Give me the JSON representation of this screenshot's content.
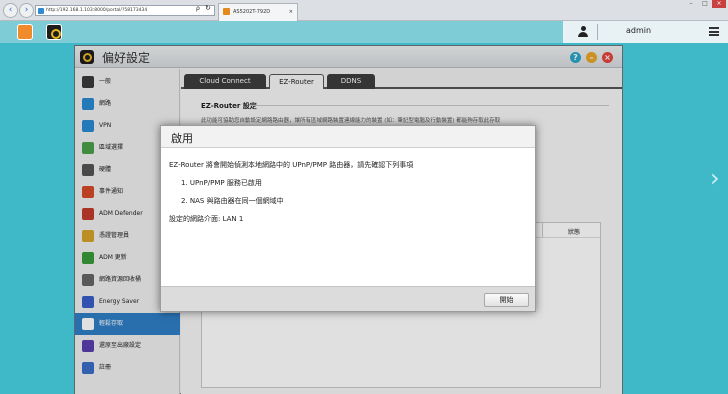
{
  "browser": {
    "url": "http://192.168.1.103:8000/portal/?58173434",
    "tab_title": "AS5202T-792D",
    "nav_back_icon": "back-arrow-icon",
    "nav_forward_icon": "forward-arrow-icon",
    "search_glyph": "ρ",
    "refresh_glyph": "↻"
  },
  "topbar": {
    "username": "admin"
  },
  "window": {
    "title": "偏好設定",
    "colors": {
      "help": "#2aa6c9",
      "minimize": "#e8a628",
      "close": "#e2443b"
    }
  },
  "sidebar": {
    "items": [
      {
        "label": "一般",
        "icon": "general-icon",
        "color": "#3b3b3b"
      },
      {
        "label": "網路",
        "icon": "network-icon",
        "color": "#2a8ad2"
      },
      {
        "label": "VPN",
        "icon": "vpn-icon",
        "color": "#2a8ad2"
      },
      {
        "label": "區域選擇",
        "icon": "region-icon",
        "color": "#4aa04a"
      },
      {
        "label": "硬體",
        "icon": "hardware-icon",
        "color": "#555555"
      },
      {
        "label": "事件通知",
        "icon": "notification-icon",
        "color": "#d44a2a"
      },
      {
        "label": "ADM Defender",
        "icon": "defender-icon",
        "color": "#c23b2b"
      },
      {
        "label": "憑證管理員",
        "icon": "certificate-icon",
        "color": "#d4a32a"
      },
      {
        "label": "ADM 更新",
        "icon": "update-icon",
        "color": "#3a9a3a"
      },
      {
        "label": "網路資源回收桶",
        "icon": "recycle-bin-icon",
        "color": "#666666"
      },
      {
        "label": "Energy Saver",
        "icon": "energy-saver-icon",
        "color": "#3a5ec8"
      },
      {
        "label": "輕鬆存取",
        "icon": "cloud-icon",
        "color": "#ffffff",
        "active": true
      },
      {
        "label": "還原至出廠設定",
        "icon": "restore-icon",
        "color": "#5b3fb0"
      },
      {
        "label": "註冊",
        "icon": "register-icon",
        "color": "#3a6ec8"
      }
    ]
  },
  "tabs": [
    {
      "label": "Cloud Connect"
    },
    {
      "label": "EZ-Router",
      "active": true
    },
    {
      "label": "DDNS"
    }
  ],
  "ez_router": {
    "section_title": "EZ-Router 設定",
    "description": "此功能可協助您自動設定網路路由器，讓所有區域網路裝置連線能力的裝置 (如：筆記型電腦及行動裝置) 都能夠存取此存取",
    "status_column": "狀態"
  },
  "dialog": {
    "title": "啟用",
    "intro": "EZ-Router 將會開始偵測本地網路中的 UPnP/PMP 路由器，請先確認下列事項",
    "items": [
      "1. UPnP/PMP 服務已啟用",
      "2. NAS 與路由器在同一個網域中"
    ],
    "interface": "設定的網路介面: LAN 1",
    "start_button": "開始"
  }
}
